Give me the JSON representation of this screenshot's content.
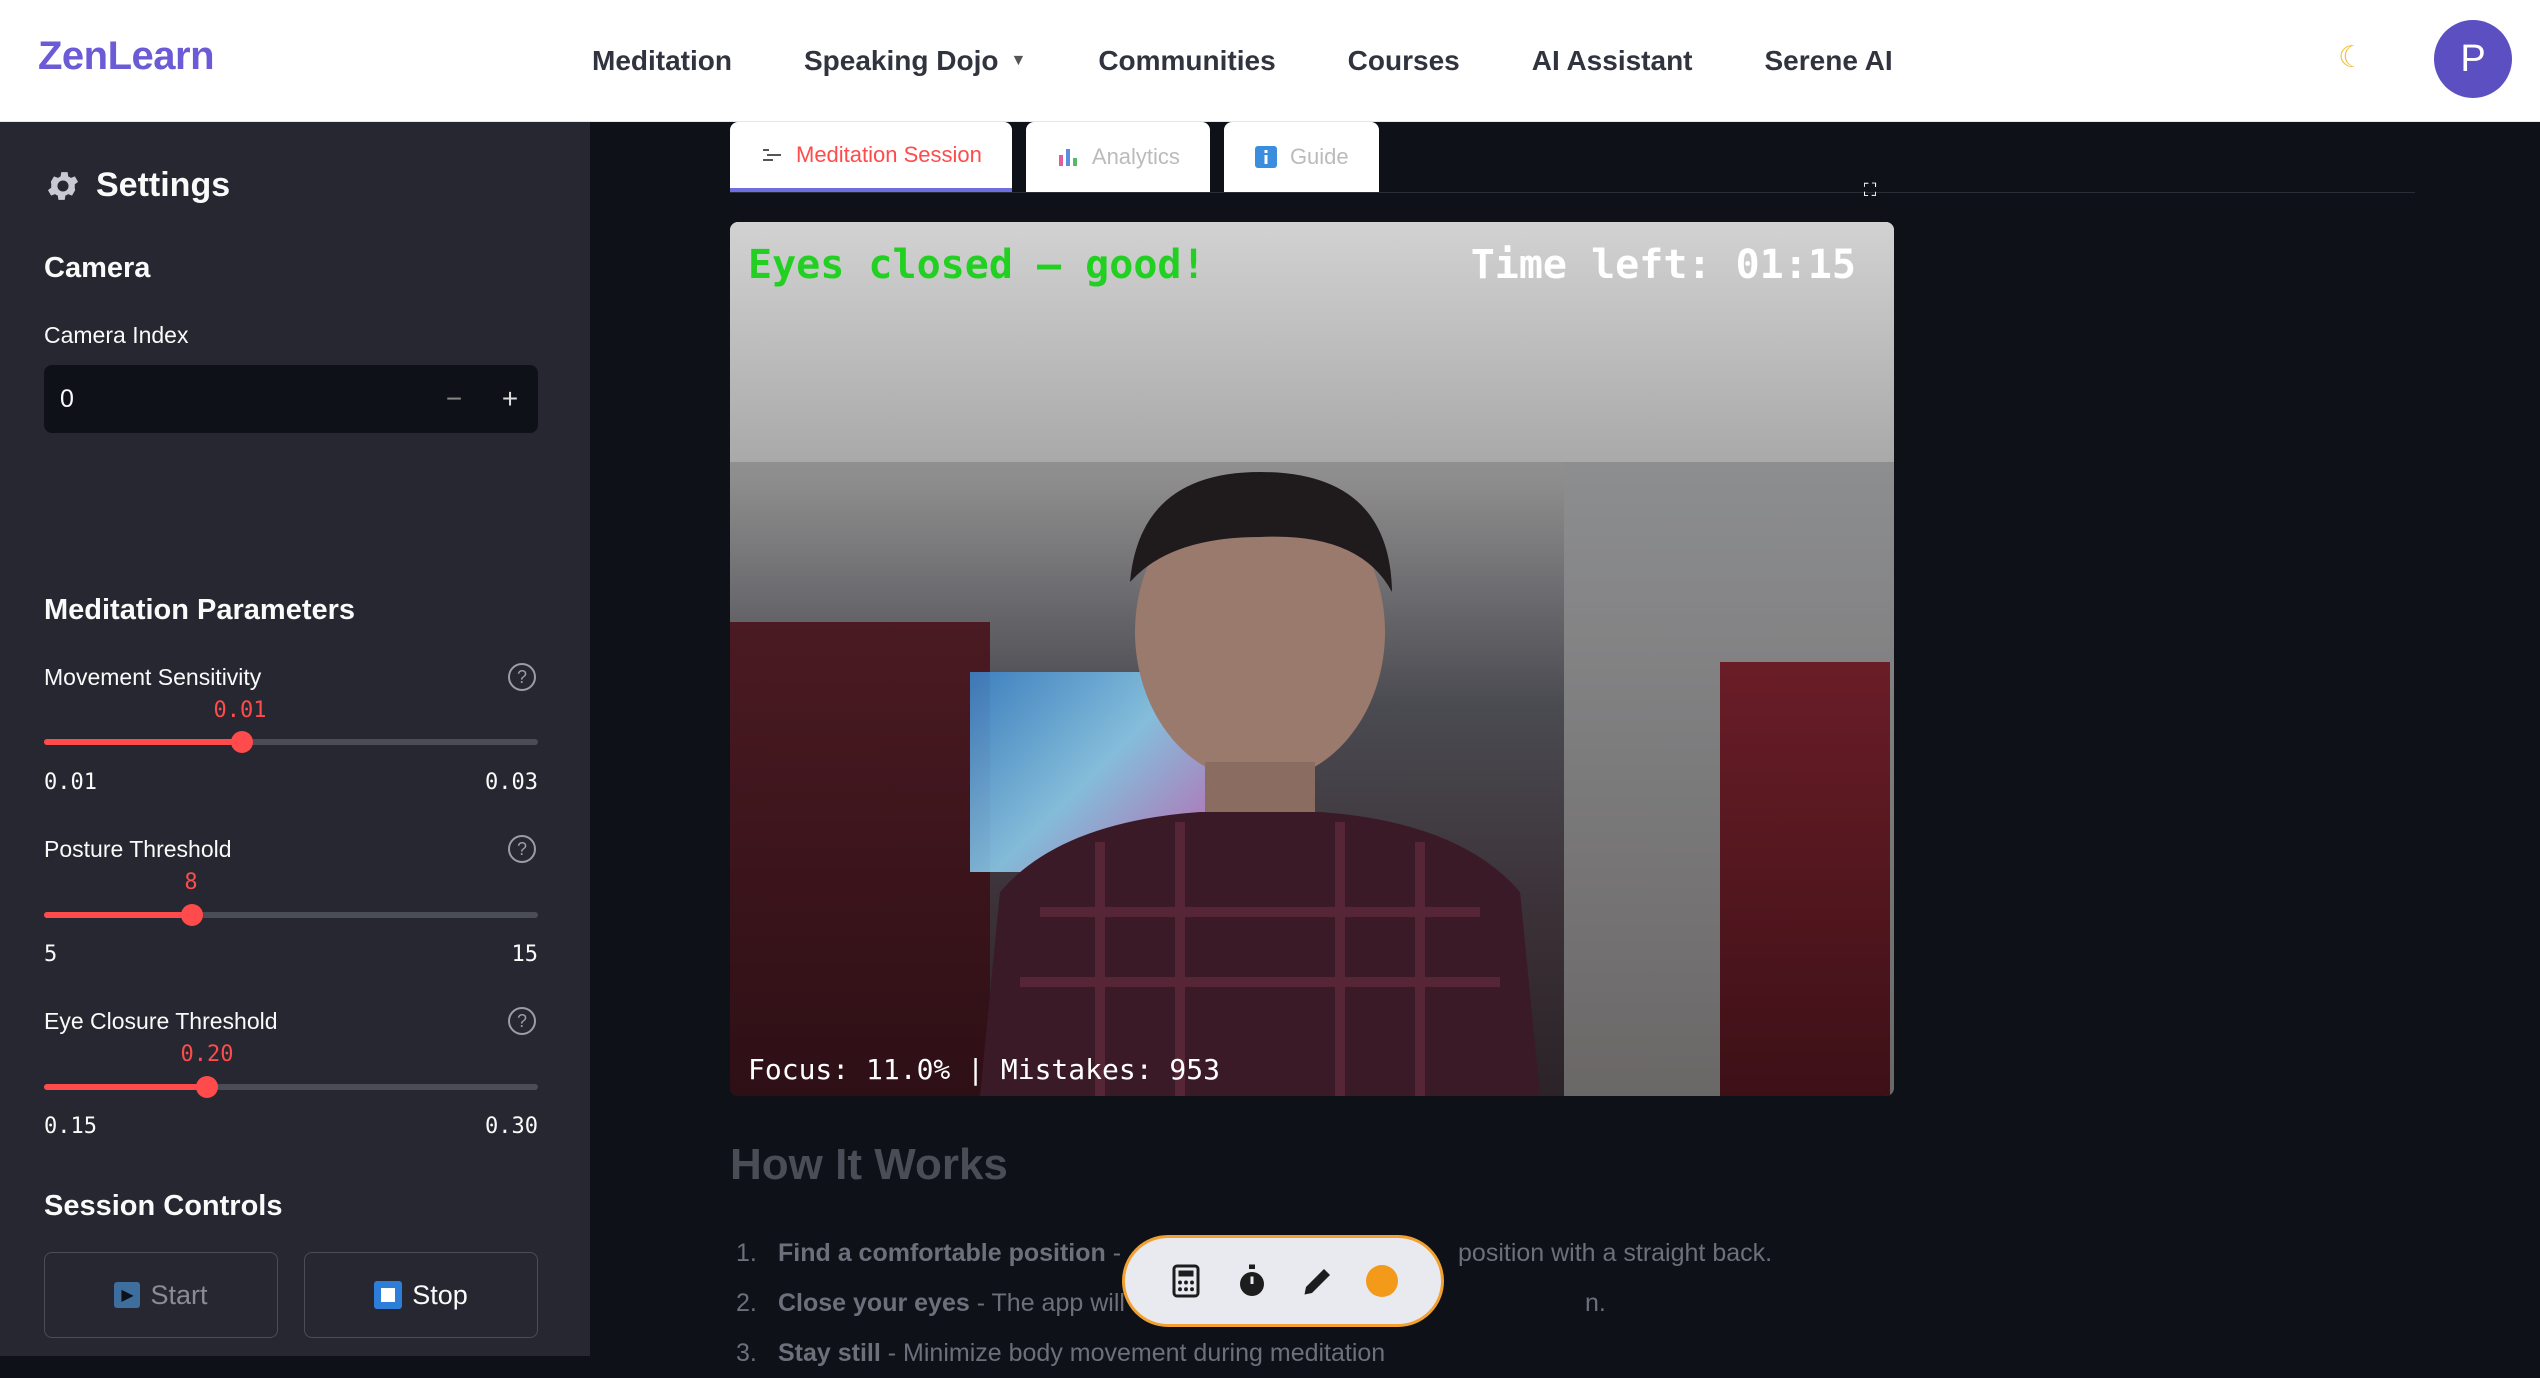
{
  "nav": {
    "brand": "ZenLearn",
    "links": [
      "Meditation",
      "Speaking Dojo",
      "Communities",
      "Courses",
      "AI Assistant",
      "Serene AI"
    ],
    "avatar": "P",
    "theme_icon": "moon-icon"
  },
  "sidebar": {
    "title": "Settings",
    "camera": {
      "heading": "Camera",
      "index_label": "Camera Index",
      "index_value": "0",
      "minus": "−",
      "plus": "+"
    },
    "params": {
      "heading": "Meditation Parameters",
      "movement": {
        "label": "Movement Sensitivity",
        "value": "0.01",
        "min": "0.01",
        "max": "0.03",
        "fraction": 0.4
      },
      "posture": {
        "label": "Posture Threshold",
        "value": "8",
        "min": "5",
        "max": "15",
        "fraction": 0.3
      },
      "eye": {
        "label": "Eye Closure Threshold",
        "value": "0.20",
        "min": "0.15",
        "max": "0.30",
        "fraction": 0.33
      },
      "help": "?"
    },
    "controls": {
      "heading": "Session Controls",
      "start": "Start",
      "stop": "Stop"
    }
  },
  "tabs": [
    "Meditation Session",
    "Analytics",
    "Guide"
  ],
  "video": {
    "status": "Eyes closed — good!",
    "time_left": "Time left: 01:15",
    "stats": "Focus: 11.0% | Mistakes: 953"
  },
  "how": {
    "title": "How It Works",
    "items": [
      {
        "n": "1.",
        "bold": "Find a comfortable position",
        "text": " - ",
        "tail": "position with a straight back."
      },
      {
        "n": "2.",
        "bold": "Close your eyes",
        "text": " - The app will",
        "tail": "n."
      },
      {
        "n": "3.",
        "bold": "Stay still",
        "text": " - Minimize body movement during meditation",
        "tail": ""
      }
    ]
  },
  "colors": {
    "accent": "#ff4b4b",
    "brand": "#6b5bd6",
    "status_green": "#22d022",
    "fab_orange": "#f49a1a"
  }
}
